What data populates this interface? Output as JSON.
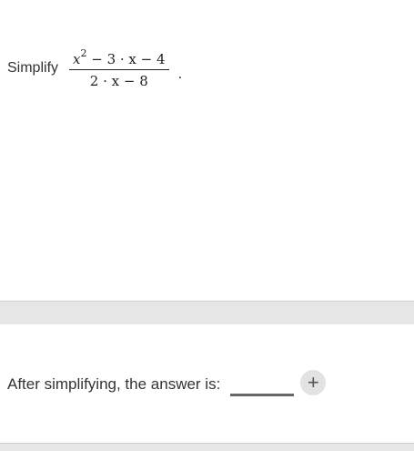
{
  "question": {
    "prompt_label": "Simplify",
    "fraction": {
      "numerator_base": "x",
      "numerator_exponent": "2",
      "numerator_rest": " − 3 · x − 4",
      "denominator": "2 · x − 8"
    },
    "trailing_punctuation": "."
  },
  "answer": {
    "label": "After simplifying, the answer is:",
    "add_button_glyph": "+"
  }
}
